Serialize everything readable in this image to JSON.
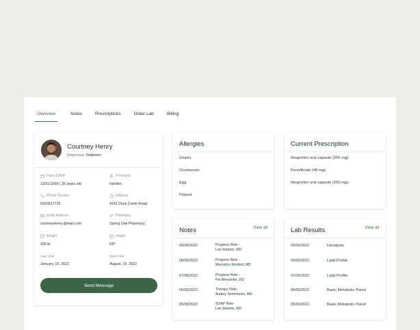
{
  "tabs": [
    {
      "label": "Overview",
      "active": true
    },
    {
      "label": "Notes",
      "active": false
    },
    {
      "label": "Prescriptions",
      "active": false
    },
    {
      "label": "Order Lab",
      "active": false
    },
    {
      "label": "Billing",
      "active": false
    }
  ],
  "profile": {
    "name": "Courtney Henry",
    "diagnosis_label": "Diagnosis:",
    "diagnosis_value": "Diabetes",
    "fields": {
      "dob_label": "Date of Birth",
      "dob_value": "12/01/1996 | 26 years old",
      "pronouns_label": "Pronouns",
      "pronouns_value": "He/Him",
      "phone_label": "Phone Number",
      "phone_value": "0916617726",
      "address_label": "Address",
      "address_value": "4141 Duck Creek Road.",
      "email_label": "Email Address",
      "email_value": "courtneyhenry@mail.com",
      "pharmacy_label": "Pharmacy",
      "pharmacy_value": "Spring Oak Pharmacy",
      "weight_label": "Weight",
      "weight_value": "200 lb",
      "height_label": "Height",
      "height_value": "5'8\"",
      "last_visit_label": "Last Visit",
      "last_visit_value": "January, 15, 2022",
      "next_visit_label": "Next Visit",
      "next_visit_value": "August, 15, 2022"
    },
    "send_message": "Send Message"
  },
  "allergies": {
    "title": "Allergies",
    "items": [
      "Gluten",
      "Crustacean",
      "Egg",
      "Peanut"
    ]
  },
  "prescription": {
    "title": "Current Prescription",
    "items": [
      "Ibruprofen oral capsule (200 mg)",
      "Fenofibrate (48 mg)",
      "Ibruprofen oral capsule (200 mg)"
    ]
  },
  "notes": {
    "title": "Notes",
    "view_all": "View all",
    "rows": [
      {
        "date": "09/06/2022",
        "line1": "Progress Note -",
        "line2": "Leo Stanton, MD"
      },
      {
        "date": "08/06/2022",
        "line1": "Progress Note -",
        "line2": "Marcelino Kindred, MD"
      },
      {
        "date": "07/06/2022",
        "line1": "Progress Note -",
        "line2": "Pat Alexander, DO"
      },
      {
        "date": "06/06/2022",
        "line1": "Therapy Note -",
        "line2": "Audrey Simmmons, MD"
      },
      {
        "date": "05/06/2022",
        "line1": "SOAP Note -",
        "line2": "Leo Stanton, MD"
      }
    ]
  },
  "labs": {
    "title": "Lab Results",
    "view_all": "View all",
    "rows": [
      {
        "date": "09/06/2022",
        "name": "Urinalysis"
      },
      {
        "date": "08/06/2022",
        "name": "Lipid Profile"
      },
      {
        "date": "07/06/2022",
        "name": "Lipid Profile"
      },
      {
        "date": "06/06/2022",
        "name": "Basic Metabolic Panel"
      },
      {
        "date": "05/06/2022",
        "name": "Basic Metabolic Panel"
      }
    ]
  },
  "colors": {
    "accent": "#3e6b4a",
    "button": "#3c6447",
    "background": "#eeeee8"
  }
}
